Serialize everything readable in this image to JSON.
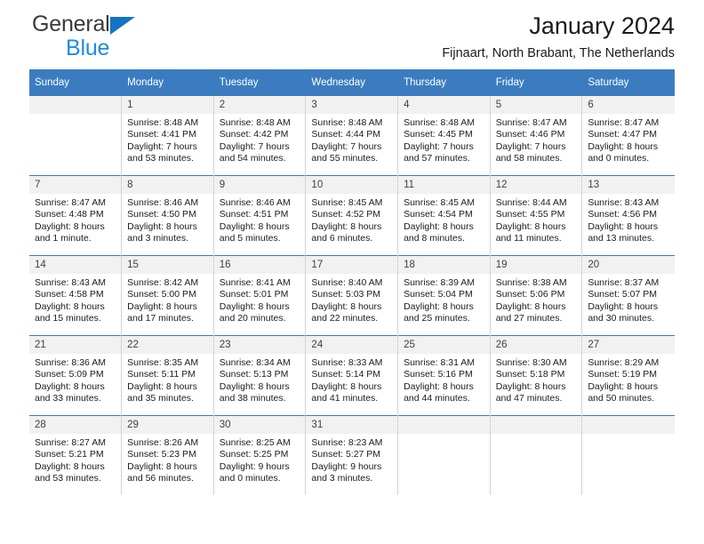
{
  "brand": {
    "name_part1": "General",
    "name_part2": "Blue",
    "triangle_color": "#1573c6"
  },
  "header": {
    "title": "January 2024",
    "subtitle": "Fijnaart, North Brabant, The Netherlands",
    "accent_color": "#3b7cc0"
  },
  "weekday_headers": [
    "Sunday",
    "Monday",
    "Tuesday",
    "Wednesday",
    "Thursday",
    "Friday",
    "Saturday"
  ],
  "weeks": [
    [
      {
        "day": "",
        "sunrise": "",
        "sunset": "",
        "daylight1": "",
        "daylight2": ""
      },
      {
        "day": "1",
        "sunrise": "Sunrise: 8:48 AM",
        "sunset": "Sunset: 4:41 PM",
        "daylight1": "Daylight: 7 hours",
        "daylight2": "and 53 minutes."
      },
      {
        "day": "2",
        "sunrise": "Sunrise: 8:48 AM",
        "sunset": "Sunset: 4:42 PM",
        "daylight1": "Daylight: 7 hours",
        "daylight2": "and 54 minutes."
      },
      {
        "day": "3",
        "sunrise": "Sunrise: 8:48 AM",
        "sunset": "Sunset: 4:44 PM",
        "daylight1": "Daylight: 7 hours",
        "daylight2": "and 55 minutes."
      },
      {
        "day": "4",
        "sunrise": "Sunrise: 8:48 AM",
        "sunset": "Sunset: 4:45 PM",
        "daylight1": "Daylight: 7 hours",
        "daylight2": "and 57 minutes."
      },
      {
        "day": "5",
        "sunrise": "Sunrise: 8:47 AM",
        "sunset": "Sunset: 4:46 PM",
        "daylight1": "Daylight: 7 hours",
        "daylight2": "and 58 minutes."
      },
      {
        "day": "6",
        "sunrise": "Sunrise: 8:47 AM",
        "sunset": "Sunset: 4:47 PM",
        "daylight1": "Daylight: 8 hours",
        "daylight2": "and 0 minutes."
      }
    ],
    [
      {
        "day": "7",
        "sunrise": "Sunrise: 8:47 AM",
        "sunset": "Sunset: 4:48 PM",
        "daylight1": "Daylight: 8 hours",
        "daylight2": "and 1 minute."
      },
      {
        "day": "8",
        "sunrise": "Sunrise: 8:46 AM",
        "sunset": "Sunset: 4:50 PM",
        "daylight1": "Daylight: 8 hours",
        "daylight2": "and 3 minutes."
      },
      {
        "day": "9",
        "sunrise": "Sunrise: 8:46 AM",
        "sunset": "Sunset: 4:51 PM",
        "daylight1": "Daylight: 8 hours",
        "daylight2": "and 5 minutes."
      },
      {
        "day": "10",
        "sunrise": "Sunrise: 8:45 AM",
        "sunset": "Sunset: 4:52 PM",
        "daylight1": "Daylight: 8 hours",
        "daylight2": "and 6 minutes."
      },
      {
        "day": "11",
        "sunrise": "Sunrise: 8:45 AM",
        "sunset": "Sunset: 4:54 PM",
        "daylight1": "Daylight: 8 hours",
        "daylight2": "and 8 minutes."
      },
      {
        "day": "12",
        "sunrise": "Sunrise: 8:44 AM",
        "sunset": "Sunset: 4:55 PM",
        "daylight1": "Daylight: 8 hours",
        "daylight2": "and 11 minutes."
      },
      {
        "day": "13",
        "sunrise": "Sunrise: 8:43 AM",
        "sunset": "Sunset: 4:56 PM",
        "daylight1": "Daylight: 8 hours",
        "daylight2": "and 13 minutes."
      }
    ],
    [
      {
        "day": "14",
        "sunrise": "Sunrise: 8:43 AM",
        "sunset": "Sunset: 4:58 PM",
        "daylight1": "Daylight: 8 hours",
        "daylight2": "and 15 minutes."
      },
      {
        "day": "15",
        "sunrise": "Sunrise: 8:42 AM",
        "sunset": "Sunset: 5:00 PM",
        "daylight1": "Daylight: 8 hours",
        "daylight2": "and 17 minutes."
      },
      {
        "day": "16",
        "sunrise": "Sunrise: 8:41 AM",
        "sunset": "Sunset: 5:01 PM",
        "daylight1": "Daylight: 8 hours",
        "daylight2": "and 20 minutes."
      },
      {
        "day": "17",
        "sunrise": "Sunrise: 8:40 AM",
        "sunset": "Sunset: 5:03 PM",
        "daylight1": "Daylight: 8 hours",
        "daylight2": "and 22 minutes."
      },
      {
        "day": "18",
        "sunrise": "Sunrise: 8:39 AM",
        "sunset": "Sunset: 5:04 PM",
        "daylight1": "Daylight: 8 hours",
        "daylight2": "and 25 minutes."
      },
      {
        "day": "19",
        "sunrise": "Sunrise: 8:38 AM",
        "sunset": "Sunset: 5:06 PM",
        "daylight1": "Daylight: 8 hours",
        "daylight2": "and 27 minutes."
      },
      {
        "day": "20",
        "sunrise": "Sunrise: 8:37 AM",
        "sunset": "Sunset: 5:07 PM",
        "daylight1": "Daylight: 8 hours",
        "daylight2": "and 30 minutes."
      }
    ],
    [
      {
        "day": "21",
        "sunrise": "Sunrise: 8:36 AM",
        "sunset": "Sunset: 5:09 PM",
        "daylight1": "Daylight: 8 hours",
        "daylight2": "and 33 minutes."
      },
      {
        "day": "22",
        "sunrise": "Sunrise: 8:35 AM",
        "sunset": "Sunset: 5:11 PM",
        "daylight1": "Daylight: 8 hours",
        "daylight2": "and 35 minutes."
      },
      {
        "day": "23",
        "sunrise": "Sunrise: 8:34 AM",
        "sunset": "Sunset: 5:13 PM",
        "daylight1": "Daylight: 8 hours",
        "daylight2": "and 38 minutes."
      },
      {
        "day": "24",
        "sunrise": "Sunrise: 8:33 AM",
        "sunset": "Sunset: 5:14 PM",
        "daylight1": "Daylight: 8 hours",
        "daylight2": "and 41 minutes."
      },
      {
        "day": "25",
        "sunrise": "Sunrise: 8:31 AM",
        "sunset": "Sunset: 5:16 PM",
        "daylight1": "Daylight: 8 hours",
        "daylight2": "and 44 minutes."
      },
      {
        "day": "26",
        "sunrise": "Sunrise: 8:30 AM",
        "sunset": "Sunset: 5:18 PM",
        "daylight1": "Daylight: 8 hours",
        "daylight2": "and 47 minutes."
      },
      {
        "day": "27",
        "sunrise": "Sunrise: 8:29 AM",
        "sunset": "Sunset: 5:19 PM",
        "daylight1": "Daylight: 8 hours",
        "daylight2": "and 50 minutes."
      }
    ],
    [
      {
        "day": "28",
        "sunrise": "Sunrise: 8:27 AM",
        "sunset": "Sunset: 5:21 PM",
        "daylight1": "Daylight: 8 hours",
        "daylight2": "and 53 minutes."
      },
      {
        "day": "29",
        "sunrise": "Sunrise: 8:26 AM",
        "sunset": "Sunset: 5:23 PM",
        "daylight1": "Daylight: 8 hours",
        "daylight2": "and 56 minutes."
      },
      {
        "day": "30",
        "sunrise": "Sunrise: 8:25 AM",
        "sunset": "Sunset: 5:25 PM",
        "daylight1": "Daylight: 9 hours",
        "daylight2": "and 0 minutes."
      },
      {
        "day": "31",
        "sunrise": "Sunrise: 8:23 AM",
        "sunset": "Sunset: 5:27 PM",
        "daylight1": "Daylight: 9 hours",
        "daylight2": "and 3 minutes."
      },
      {
        "day": "",
        "sunrise": "",
        "sunset": "",
        "daylight1": "",
        "daylight2": ""
      },
      {
        "day": "",
        "sunrise": "",
        "sunset": "",
        "daylight1": "",
        "daylight2": ""
      },
      {
        "day": "",
        "sunrise": "",
        "sunset": "",
        "daylight1": "",
        "daylight2": ""
      }
    ]
  ]
}
